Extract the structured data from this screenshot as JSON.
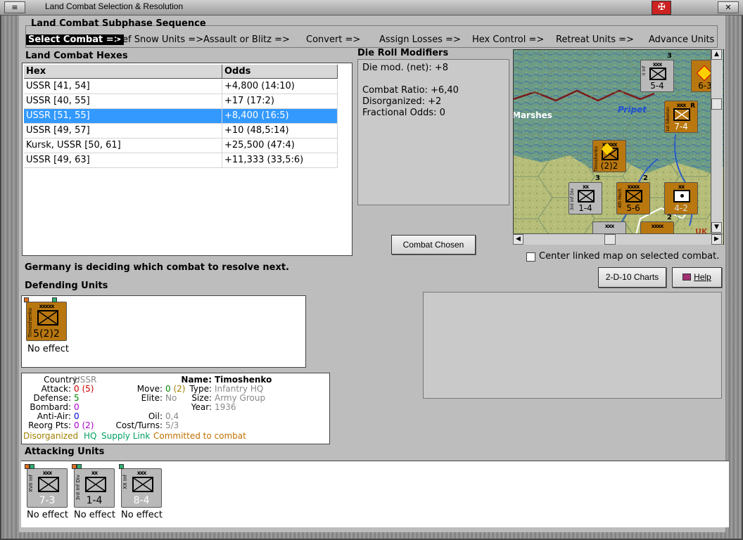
{
  "window": {
    "title": "Land Combat Selection & Resolution"
  },
  "subphase": {
    "title": "Land Combat Subphase Sequence",
    "steps": [
      "Select Combat =>",
      "Def Snow Units =>",
      "Assault or Blitz =>",
      "Convert =>",
      "Assign Losses =>",
      "Hex Control =>",
      "Retreat Units =>",
      "Advance Units"
    ]
  },
  "hexes": {
    "label": "Land Combat Hexes",
    "columns": [
      "Hex",
      "Odds"
    ],
    "rows": [
      {
        "hex": "USSR [41, 54]",
        "odds": "+4,800 (14:10)"
      },
      {
        "hex": "USSR [40, 55]",
        "odds": "+17 (17:2)"
      },
      {
        "hex": "USSR [51, 55]",
        "odds": "+8,400 (16:5)"
      },
      {
        "hex": "USSR [49, 57]",
        "odds": "+10 (48,5:14)"
      },
      {
        "hex": "Kursk, USSR [50, 61]",
        "odds": "+25,500 (47:4)"
      },
      {
        "hex": "USSR [49, 63]",
        "odds": "+11,333 (33,5:6)"
      }
    ],
    "selected_index": 2
  },
  "drm": {
    "label": "Die Roll Modifiers",
    "lines": [
      "Die mod. (net): +8",
      "",
      "Combat Ratio: +6,40",
      "Disorganized: +2",
      "Fractional Odds: 0"
    ]
  },
  "map": {
    "labels": {
      "marshes": "Marshes",
      "pripet": "Pripet",
      "uk": "UK"
    },
    "units": [
      {
        "size": "xxx",
        "name": "II Inf",
        "value": "5-4",
        "badge": "3"
      },
      {
        "size": "xxx",
        "name": "1st Siberian",
        "value": "7-4",
        "badge": "R"
      },
      {
        "size": "xxxxx",
        "name": "Timoshenko",
        "value": "(2)2",
        "badge": ""
      },
      {
        "size": "xx",
        "name": "3rd Inf Div",
        "value": "1-4",
        "badge": "3"
      },
      {
        "size": "xxxx",
        "name": "4th Mech",
        "value": "5-6",
        "badge": "2"
      },
      {
        "size": "xx",
        "name": "",
        "value": "4-2",
        "badge": ""
      },
      {
        "size": "",
        "name": "",
        "value": "6-3",
        "badge": "3"
      },
      {
        "size": "xxx",
        "name": "",
        "value": "",
        "badge": ""
      },
      {
        "size": "xxxx",
        "name": "",
        "value": "",
        "badge": "2"
      }
    ]
  },
  "controls": {
    "combat_chosen": "Combat Chosen",
    "center_label": "Center linked map on selected combat.",
    "charts": "2-D-10 Charts",
    "help": "Help"
  },
  "status": "Germany is deciding which combat to resolve next.",
  "defending": {
    "label": "Defending Units",
    "units": [
      {
        "size": "xxxxx",
        "name": "Timoshenko",
        "value": "5(2)2",
        "status": "No effect"
      }
    ]
  },
  "details": {
    "country_label": "Country:",
    "country": "USSR",
    "attack_label": "Attack:",
    "attack": "0",
    "attack_alt": "(5)",
    "defense_label": "Defense:",
    "defense": "5",
    "bombard_label": "Bombard:",
    "bombard": "0",
    "antiair_label": "Anti-Air:",
    "antiair": "0",
    "reorg_label": "Reorg Pts:",
    "reorg": "0",
    "reorg_alt": "(2)",
    "name_label": "Name:",
    "name": "Timoshenko",
    "move_label": "Move:",
    "move": "0",
    "move_alt": "(2)",
    "type_label": "Type:",
    "type": "Infantry HQ",
    "elite_label": "Elite:",
    "elite": "No",
    "size_label": "Size:",
    "size": "Army Group",
    "year_label": "Year:",
    "year": "1936",
    "oil_label": "Oil:",
    "oil": "0,4",
    "cost_label": "Cost/Turns:",
    "cost": "5/3",
    "flags": [
      "Disorganized",
      "HQ",
      "Supply Link",
      "Committed to combat"
    ]
  },
  "attacking": {
    "label": "Attacking Units",
    "units": [
      {
        "size": "xxx",
        "name": "XVII Inf",
        "value": "7-3",
        "status": "No effect"
      },
      {
        "size": "xx",
        "name": "3rd Inf Div",
        "value": "1-4",
        "status": "No effect"
      },
      {
        "size": "xxx",
        "name": "XX Inf",
        "value": "8-4",
        "status": "No effect"
      }
    ]
  },
  "colors": {
    "soviet": "#b8770f",
    "german": "#b9b9b9",
    "selection": "#3399ff"
  }
}
